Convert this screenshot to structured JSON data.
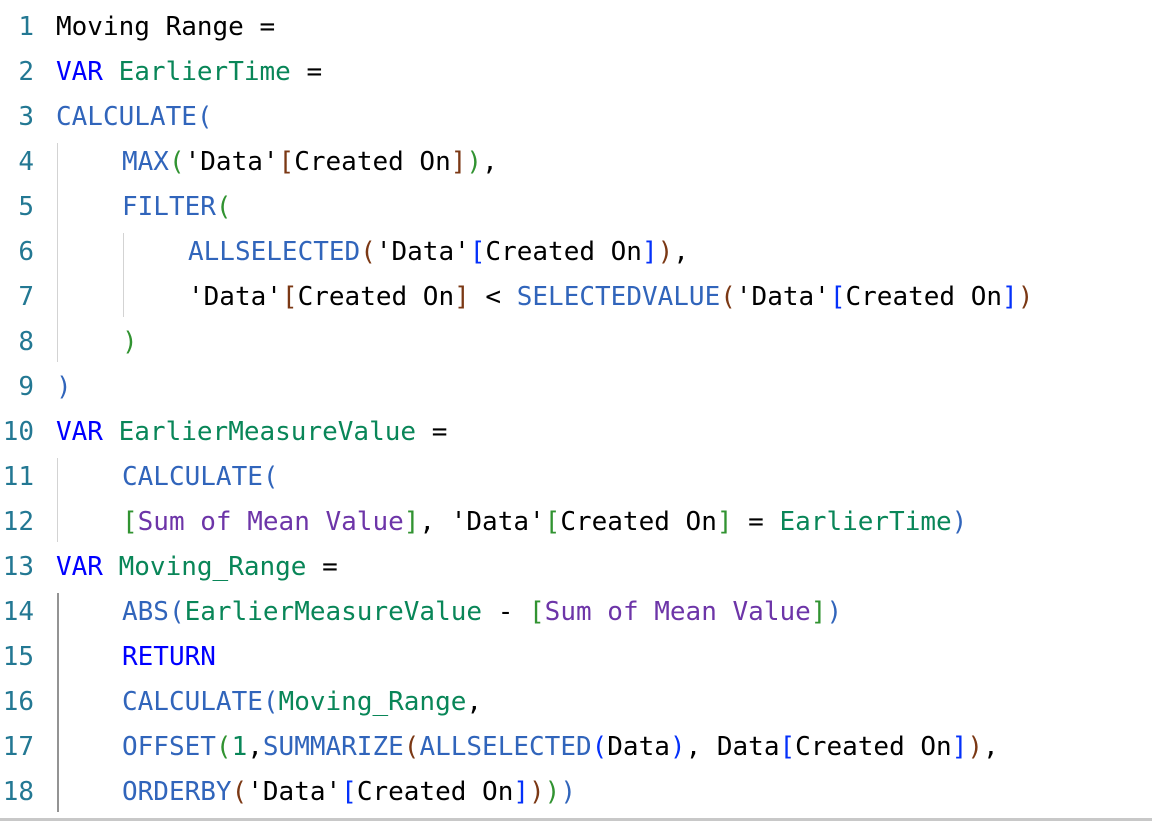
{
  "colors": {
    "line_number": "#237893",
    "plain": "#000000",
    "keyword": "#0000ff",
    "function": "#3165bb",
    "variable": "#098658",
    "string": "#a31515",
    "measure": "#6d35a8",
    "bracket1": "#319331",
    "bracket2": "#7b3814",
    "bracket3": "#0431fa"
  },
  "lines": [
    {
      "num": "1",
      "indent": 0,
      "tokens": [
        [
          "Moving Range =",
          "plain"
        ]
      ]
    },
    {
      "num": "2",
      "indent": 0,
      "tokens": [
        [
          "VAR ",
          "keyword"
        ],
        [
          "EarlierTime",
          "variable"
        ],
        [
          " =",
          "plain"
        ]
      ]
    },
    {
      "num": "3",
      "indent": 0,
      "tokens": [
        [
          "CALCULATE",
          "function"
        ],
        [
          "(",
          "function"
        ]
      ]
    },
    {
      "num": "4",
      "indent": 1,
      "tokens": [
        [
          "MAX",
          "function"
        ],
        [
          "(",
          "bracket1"
        ],
        [
          "'Data'",
          "plain"
        ],
        [
          "[",
          "bracket2"
        ],
        [
          "Created On",
          "plain"
        ],
        [
          "]",
          "bracket2"
        ],
        [
          ")",
          "bracket1"
        ],
        [
          ",",
          "plain"
        ]
      ]
    },
    {
      "num": "5",
      "indent": 1,
      "tokens": [
        [
          "FILTER",
          "function"
        ],
        [
          "(",
          "bracket1"
        ]
      ]
    },
    {
      "num": "6",
      "indent": 2,
      "tokens": [
        [
          "ALLSELECTED",
          "function"
        ],
        [
          "(",
          "bracket2"
        ],
        [
          "'Data'",
          "plain"
        ],
        [
          "[",
          "bracket3"
        ],
        [
          "Created On",
          "plain"
        ],
        [
          "]",
          "bracket3"
        ],
        [
          ")",
          "bracket2"
        ],
        [
          ",",
          "plain"
        ]
      ]
    },
    {
      "num": "7",
      "indent": 2,
      "tokens": [
        [
          "'Data'",
          "plain"
        ],
        [
          "[",
          "bracket2"
        ],
        [
          "Created On",
          "plain"
        ],
        [
          "]",
          "bracket2"
        ],
        [
          " < ",
          "plain"
        ],
        [
          "SELECTEDVALUE",
          "function"
        ],
        [
          "(",
          "bracket2"
        ],
        [
          "'Data'",
          "plain"
        ],
        [
          "[",
          "bracket3"
        ],
        [
          "Created On",
          "plain"
        ],
        [
          "]",
          "bracket3"
        ],
        [
          ")",
          "bracket2"
        ]
      ]
    },
    {
      "num": "8",
      "indent": 1,
      "tokens": [
        [
          ")",
          "bracket1"
        ]
      ]
    },
    {
      "num": "9",
      "indent": 0,
      "tokens": [
        [
          ")",
          "function"
        ]
      ]
    },
    {
      "num": "10",
      "indent": 0,
      "tokens": [
        [
          "VAR ",
          "keyword"
        ],
        [
          "EarlierMeasureValue",
          "variable"
        ],
        [
          " =",
          "plain"
        ]
      ]
    },
    {
      "num": "11",
      "indent": 1,
      "tokens": [
        [
          "CALCULATE",
          "function"
        ],
        [
          "(",
          "function"
        ]
      ]
    },
    {
      "num": "12",
      "indent": 1,
      "tokens": [
        [
          "[",
          "bracket1"
        ],
        [
          "Sum of Mean Value",
          "measure"
        ],
        [
          "]",
          "bracket1"
        ],
        [
          ", ",
          "plain"
        ],
        [
          "'Data'",
          "plain"
        ],
        [
          "[",
          "bracket1"
        ],
        [
          "Created On",
          "plain"
        ],
        [
          "]",
          "bracket1"
        ],
        [
          " = ",
          "plain"
        ],
        [
          "EarlierTime",
          "variable"
        ],
        [
          ")",
          "function"
        ]
      ]
    },
    {
      "num": "13",
      "indent": 0,
      "tokens": [
        [
          "VAR ",
          "keyword"
        ],
        [
          "Moving_Range",
          "variable"
        ],
        [
          " =",
          "plain"
        ]
      ]
    },
    {
      "num": "14",
      "indent": 1,
      "tokens": [
        [
          "ABS",
          "function"
        ],
        [
          "(",
          "function"
        ],
        [
          "EarlierMeasureValue",
          "variable"
        ],
        [
          " - ",
          "plain"
        ],
        [
          "[",
          "bracket1"
        ],
        [
          "Sum of Mean Value",
          "measure"
        ],
        [
          "]",
          "bracket1"
        ],
        [
          ")",
          "function"
        ]
      ]
    },
    {
      "num": "15",
      "indent": 1,
      "tokens": [
        [
          "RETURN",
          "keyword"
        ]
      ]
    },
    {
      "num": "16",
      "indent": 1,
      "tokens": [
        [
          "CALCULATE",
          "function"
        ],
        [
          "(",
          "function"
        ],
        [
          "Moving_Range",
          "variable"
        ],
        [
          ",",
          "plain"
        ]
      ]
    },
    {
      "num": "17",
      "indent": 1,
      "tokens": [
        [
          "OFFSET",
          "function"
        ],
        [
          "(",
          "bracket1"
        ],
        [
          "1",
          "variable"
        ],
        [
          ",",
          "plain"
        ],
        [
          "SUMMARIZE",
          "function"
        ],
        [
          "(",
          "bracket2"
        ],
        [
          "ALLSELECTED",
          "function"
        ],
        [
          "(",
          "bracket3"
        ],
        [
          "Data",
          "plain"
        ],
        [
          ")",
          "bracket3"
        ],
        [
          ", ",
          "plain"
        ],
        [
          "Data",
          "plain"
        ],
        [
          "[",
          "bracket3"
        ],
        [
          "Created On",
          "plain"
        ],
        [
          "]",
          "bracket3"
        ],
        [
          ")",
          "bracket2"
        ],
        [
          ",",
          "plain"
        ]
      ]
    },
    {
      "num": "18",
      "indent": 1,
      "tokens": [
        [
          "ORDERBY",
          "function"
        ],
        [
          "(",
          "bracket2"
        ],
        [
          "'Data'",
          "plain"
        ],
        [
          "[",
          "bracket3"
        ],
        [
          "Created On",
          "plain"
        ],
        [
          "]",
          "bracket3"
        ],
        [
          ")",
          "bracket2"
        ],
        [
          ")",
          "bracket1"
        ],
        [
          ")",
          "function"
        ]
      ]
    }
  ]
}
